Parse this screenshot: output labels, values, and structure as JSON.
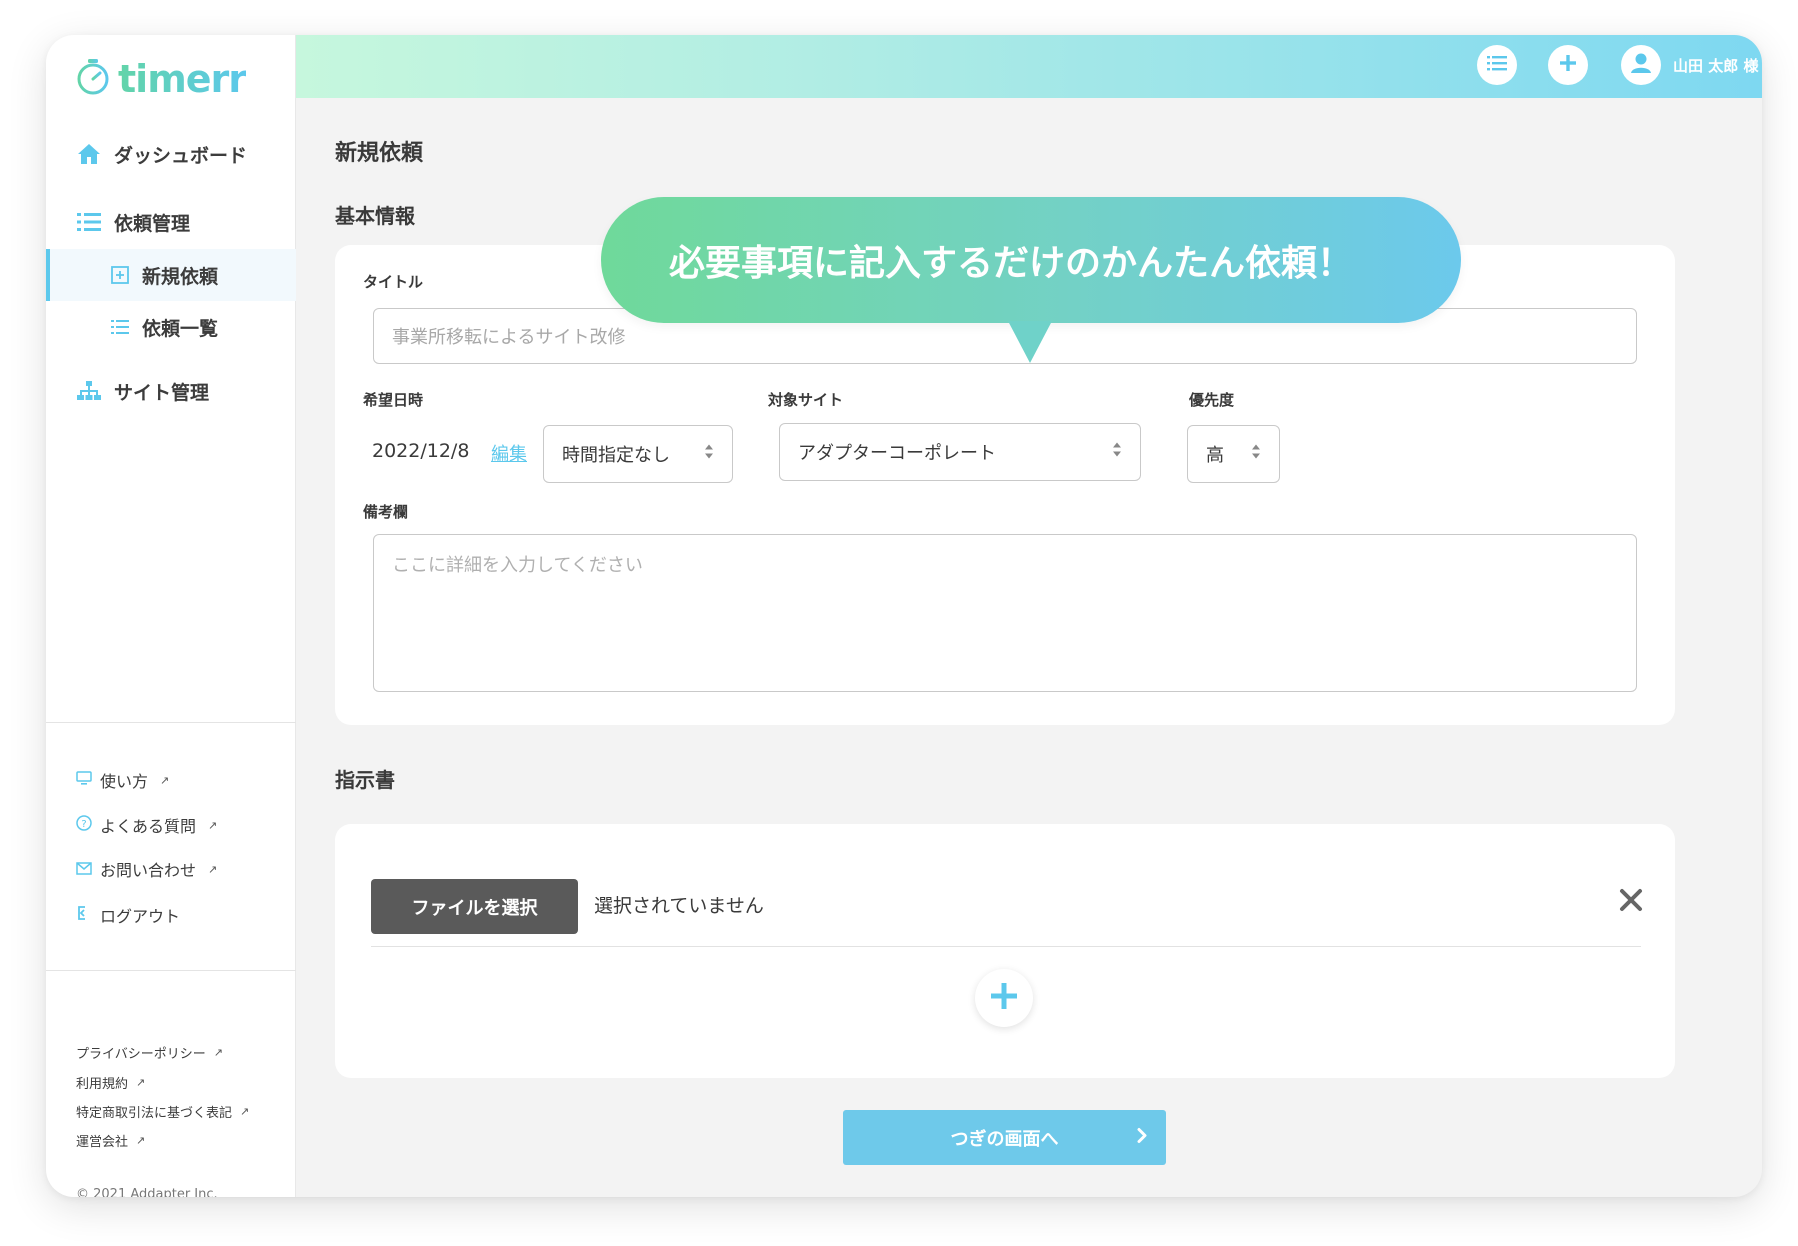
{
  "app": {
    "logo_text": "timerr"
  },
  "header": {
    "user_name": "山田 太郎 様"
  },
  "sidebar": {
    "nav": [
      {
        "label": "ダッシュボード",
        "icon": "home-icon"
      },
      {
        "label": "依頼管理",
        "icon": "list-icon"
      },
      {
        "label": "新規依頼",
        "icon": "plus-square-icon",
        "active": true
      },
      {
        "label": "依頼一覧",
        "icon": "list-icon"
      },
      {
        "label": "サイト管理",
        "icon": "sitemap-icon"
      }
    ],
    "help": [
      {
        "label": "使い方",
        "icon": "monitor-icon"
      },
      {
        "label": "よくある質問",
        "icon": "question-circle-icon"
      },
      {
        "label": "お問い合わせ",
        "icon": "mail-icon"
      },
      {
        "label": "ログアウト",
        "icon": "logout-icon"
      }
    ],
    "legal": [
      {
        "label": "プライバシーポリシー"
      },
      {
        "label": "利用規約"
      },
      {
        "label": "特定商取引法に基づく表記"
      },
      {
        "label": "運営会社"
      }
    ],
    "copyright": "© 2021 Addapter Inc."
  },
  "main": {
    "page_title": "新規依頼",
    "basic_section": "基本情報",
    "bubble_text": "必要事項に記入するだけのかんたん依頼！",
    "title_label": "タイトル",
    "title_placeholder": "事業所移転によるサイト改修",
    "date_label": "希望日時",
    "date_value": "2022/12/8",
    "edit_link": "編集",
    "time_select": "時間指定なし",
    "site_label": "対象サイト",
    "site_select": "アダプターコーポレート",
    "priority_label": "優先度",
    "priority_select": "高",
    "notes_label": "備考欄",
    "notes_placeholder": "ここに詳細を入力してください",
    "instructions_section": "指示書",
    "file_button": "ファイルを選択",
    "file_status": "選択されていません",
    "next_button": "つぎの画面へ"
  },
  "colors": {
    "accent": "#5cc8ec",
    "accent_green": "#6fd99a",
    "file_button": "#5a5a5a",
    "next_button": "#6ec9ea"
  }
}
